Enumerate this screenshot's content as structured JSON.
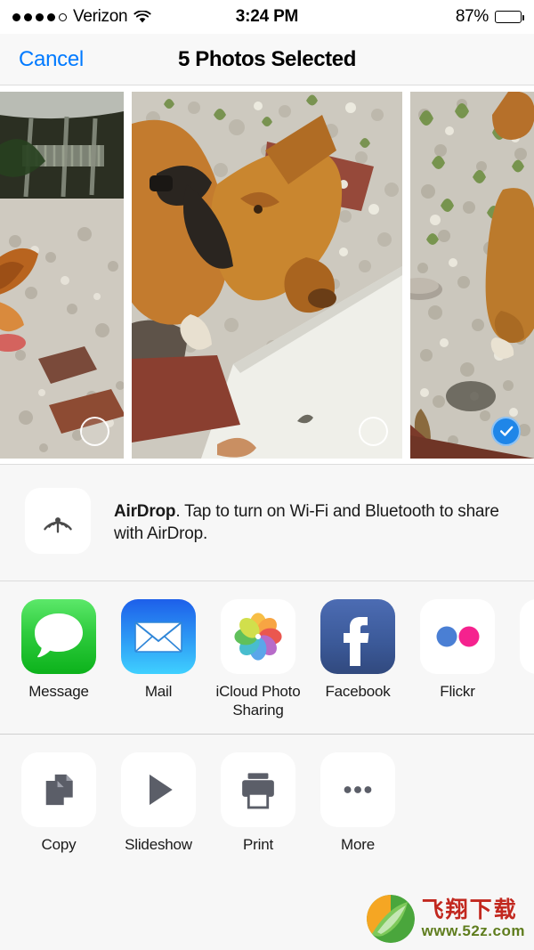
{
  "status_bar": {
    "carrier": "Verizon",
    "signal_filled": 4,
    "signal_total": 5,
    "wifi_icon": "wifi-icon",
    "time": "3:24 PM",
    "battery_percent": "87%",
    "battery_level": 87,
    "battery_icon": "battery-icon"
  },
  "nav": {
    "cancel_label": "Cancel",
    "title": "5 Photos Selected",
    "accent_color": "#007aff"
  },
  "photos": [
    {
      "name": "photo-thumbnail-1",
      "selected": false,
      "selector_icon": "circle-outline-icon",
      "alt": "Dog near metal frame on gravel"
    },
    {
      "name": "photo-thumbnail-2",
      "selected": false,
      "selector_icon": "circle-outline-icon",
      "alt": "Brown dog standing on gravel near white board"
    },
    {
      "name": "photo-thumbnail-3",
      "selected": true,
      "selector_icon": "checkmark-icon",
      "alt": "Gravel yard with dog legs"
    }
  ],
  "airdrop": {
    "icon": "airdrop-icon",
    "title": "AirDrop",
    "description": ". Tap to turn on Wi-Fi and Bluetooth to share with AirDrop."
  },
  "share_apps": [
    {
      "label": "Message",
      "icon": "messages-icon"
    },
    {
      "label": "Mail",
      "icon": "mail-icon"
    },
    {
      "label": "iCloud Photo Sharing",
      "icon": "photos-icon"
    },
    {
      "label": "Facebook",
      "icon": "facebook-icon"
    },
    {
      "label": "Flickr",
      "icon": "flickr-icon"
    }
  ],
  "actions": [
    {
      "label": "Copy",
      "icon": "copy-icon"
    },
    {
      "label": "Slideshow",
      "icon": "play-icon"
    },
    {
      "label": "Print",
      "icon": "printer-icon"
    },
    {
      "label": "More",
      "icon": "ellipsis-icon"
    }
  ],
  "watermark": {
    "brand": "飞翔下载",
    "url": "www.52z.com"
  }
}
